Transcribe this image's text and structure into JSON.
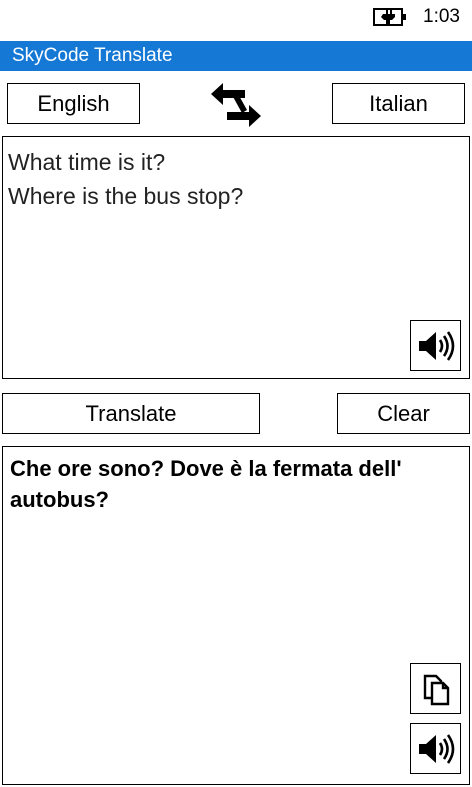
{
  "status_bar": {
    "time": "1:03",
    "battery_icon": "battery-charging-icon"
  },
  "app": {
    "title": "SkyCode Translate",
    "accent_color": "#1478d4"
  },
  "languages": {
    "source": "English",
    "target": "Italian",
    "swap_icon": "swap-arrows-icon"
  },
  "input": {
    "lines": [
      "What time is it?",
      "Where is the bus stop?"
    ],
    "speak_icon": "speaker-icon"
  },
  "actions": {
    "translate_label": "Translate",
    "clear_label": "Clear"
  },
  "output": {
    "text": "Che ore sono? Dove è la fermata dell' autobus?",
    "copy_icon": "copy-icon",
    "speak_icon": "speaker-icon"
  }
}
